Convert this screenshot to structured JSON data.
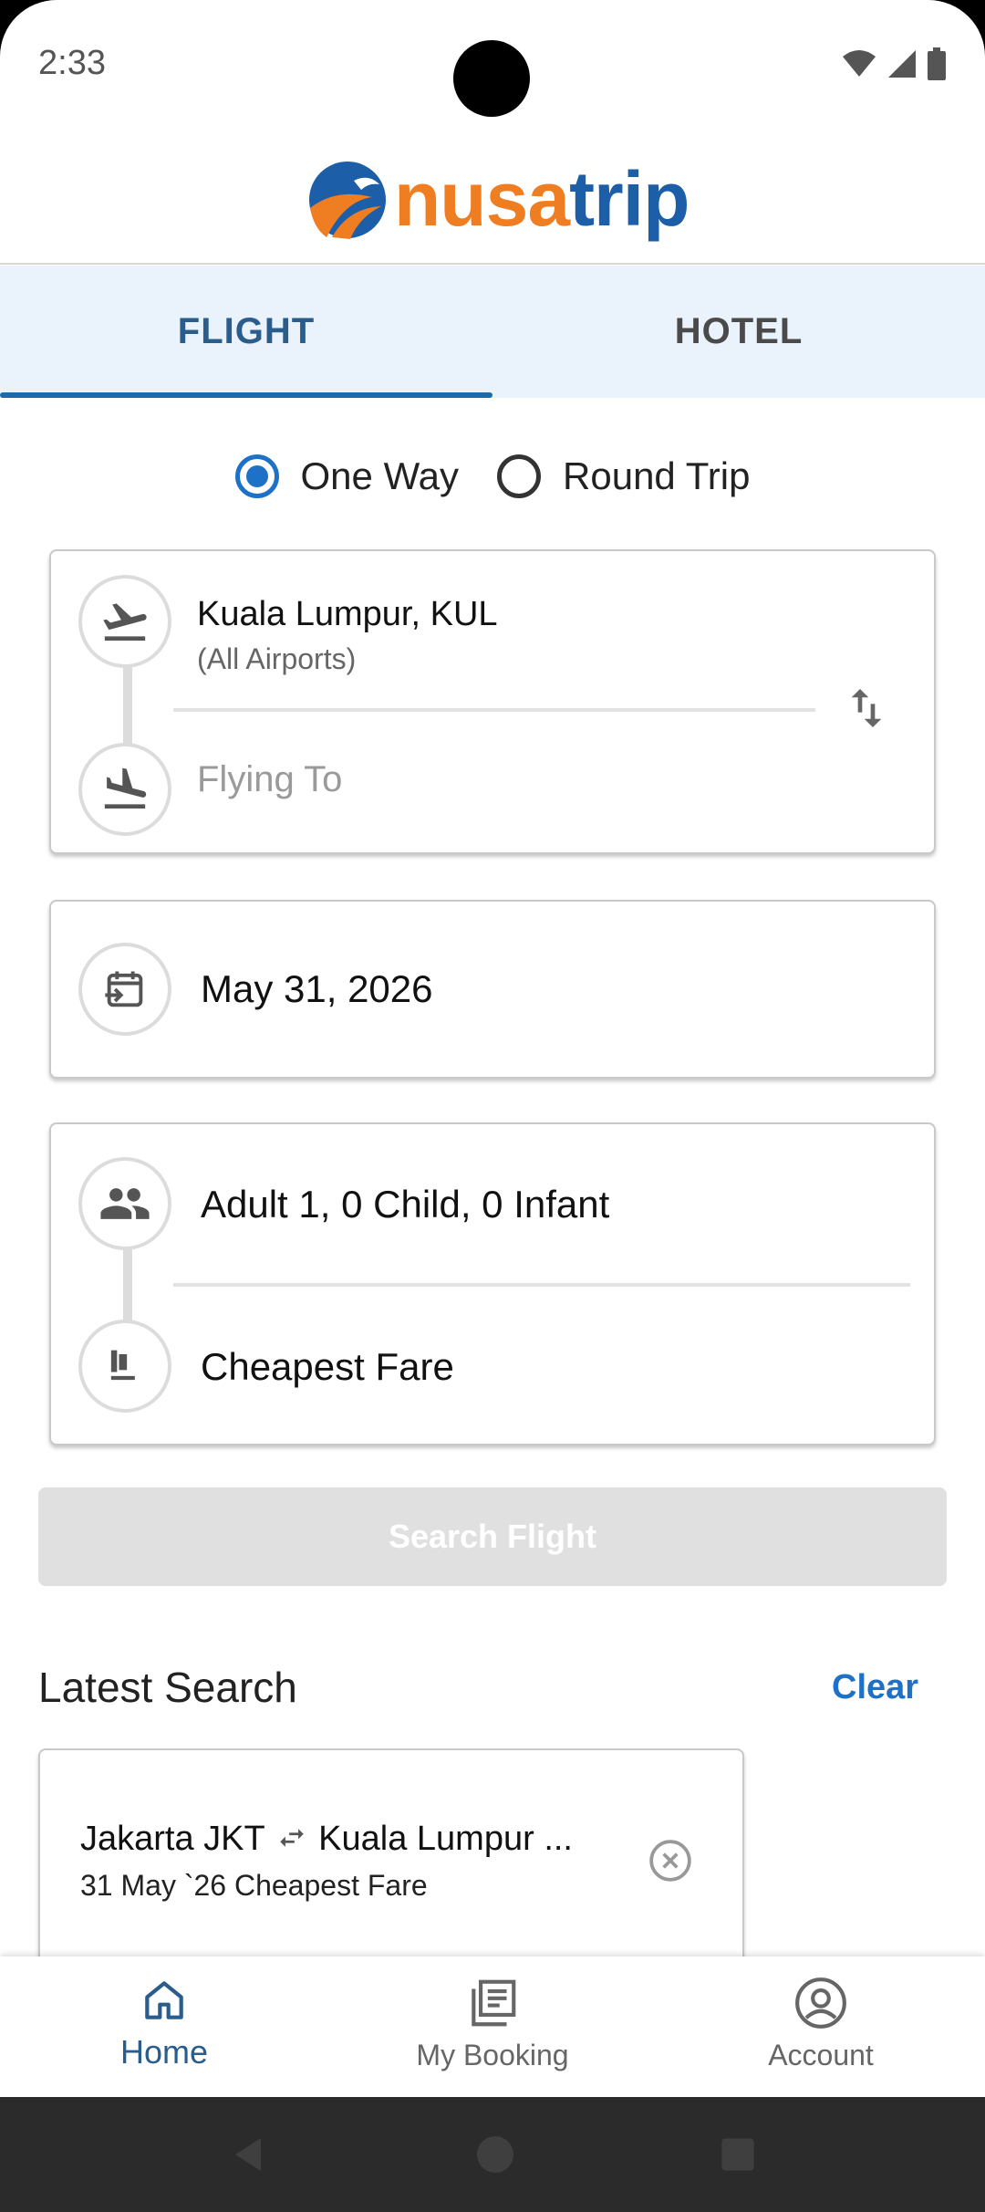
{
  "status_bar": {
    "time": "2:33"
  },
  "header": {
    "logo_part1": "nusa",
    "logo_part2": "trip"
  },
  "tabs": [
    {
      "label": "FLIGHT",
      "active": true
    },
    {
      "label": "HOTEL",
      "active": false
    }
  ],
  "trip_type": {
    "options": [
      {
        "label": "One Way",
        "selected": true
      },
      {
        "label": "Round Trip",
        "selected": false
      }
    ]
  },
  "route": {
    "origin_city": "Kuala Lumpur, KUL",
    "origin_sub": "(All Airports)",
    "destination_placeholder": "Flying To",
    "origin_icon": "flight-takeoff-icon",
    "destination_icon": "flight-land-icon",
    "swap_icon": "swap-vertical-icon"
  },
  "date": {
    "value": "May 31, 2026",
    "icon": "calendar-icon"
  },
  "passengers": {
    "value": "Adult 1, 0 Child, 0 Infant",
    "icon": "people-icon",
    "fare_class": "Cheapest Fare",
    "fare_icon": "seat-icon"
  },
  "search_button": {
    "label": "Search Flight"
  },
  "latest_search": {
    "title": "Latest Search",
    "clear_label": "Clear",
    "items": [
      {
        "from": "Jakarta JKT",
        "to": "Kuala Lumpur ...",
        "detail": "31 May `26 Cheapest Fare"
      }
    ]
  },
  "bottom_nav": [
    {
      "label": "Home",
      "icon": "home-icon",
      "active": true
    },
    {
      "label": "My Booking",
      "icon": "booking-icon",
      "active": false
    },
    {
      "label": "Account",
      "icon": "account-icon",
      "active": false
    }
  ],
  "colors": {
    "brand_blue": "#1c5ea8",
    "brand_orange": "#ef7d22",
    "accent": "#1d72c7",
    "tab_bg": "#eaf2fb"
  }
}
